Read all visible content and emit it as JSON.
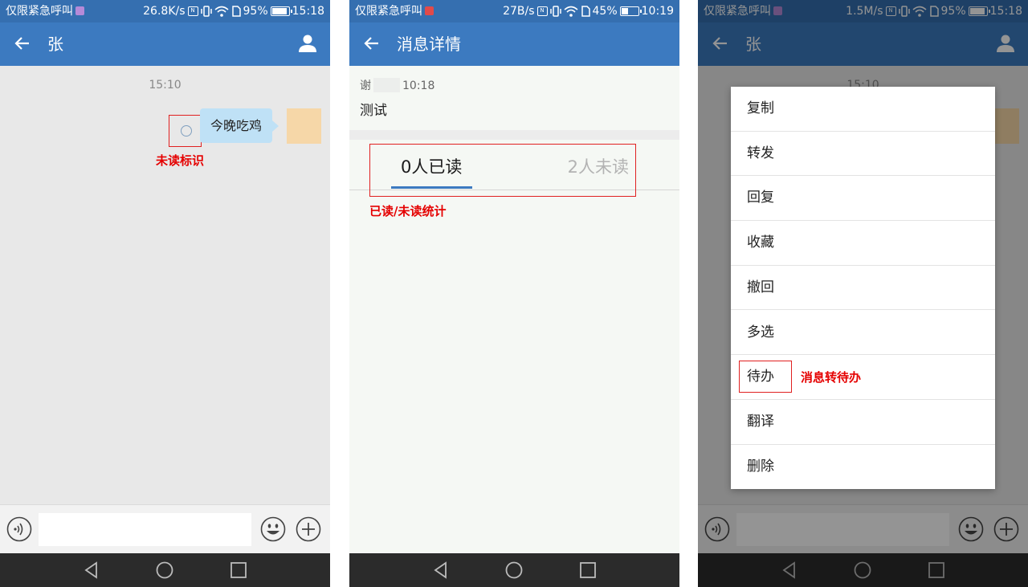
{
  "screen1": {
    "status": {
      "carrier": "仅限紧急呼叫",
      "speed": "26.8K/s",
      "battery": "95%",
      "time": "15:18",
      "battery_level": 0.95
    },
    "appbar": {
      "title": "张"
    },
    "chat": {
      "timestamp": "15:10",
      "message": "今晚吃鸡"
    },
    "annotation": {
      "label": "未读标识"
    }
  },
  "screen2": {
    "status": {
      "carrier": "仅限紧急呼叫",
      "speed": "27B/s",
      "battery": "45%",
      "time": "10:19",
      "battery_level": 0.45
    },
    "appbar": {
      "title": "消息详情"
    },
    "detail": {
      "sender": "谢",
      "time": "10:18",
      "body": "测试"
    },
    "tabs": {
      "read": "0人已读",
      "unread": "2人未读"
    },
    "annotation": {
      "label": "已读/未读统计"
    }
  },
  "screen3": {
    "status": {
      "carrier": "仅限紧急呼叫",
      "speed": "1.5M/s",
      "battery": "95%",
      "time": "15:18",
      "battery_level": 0.95
    },
    "appbar": {
      "title": "张"
    },
    "chat": {
      "timestamp": "15:10"
    },
    "menu": {
      "items": [
        "复制",
        "转发",
        "回复",
        "收藏",
        "撤回",
        "多选",
        "待办",
        "翻译",
        "删除"
      ]
    },
    "annotation": {
      "label": "消息转待办"
    }
  },
  "colors": {
    "appbar": "#3c7ac0",
    "statusbar": "#356fb0",
    "bubble": "#bfe1f6",
    "annotation": "#e02020",
    "tab_indicator": "#3c7ac0"
  },
  "icons": [
    "arrow-back-icon",
    "person-icon",
    "voice-icon",
    "emoji-icon",
    "plus-icon",
    "nav-back-icon",
    "nav-home-icon",
    "nav-recents-icon",
    "wifi-icon",
    "signal-icon",
    "battery-icon",
    "nfc-icon"
  ]
}
